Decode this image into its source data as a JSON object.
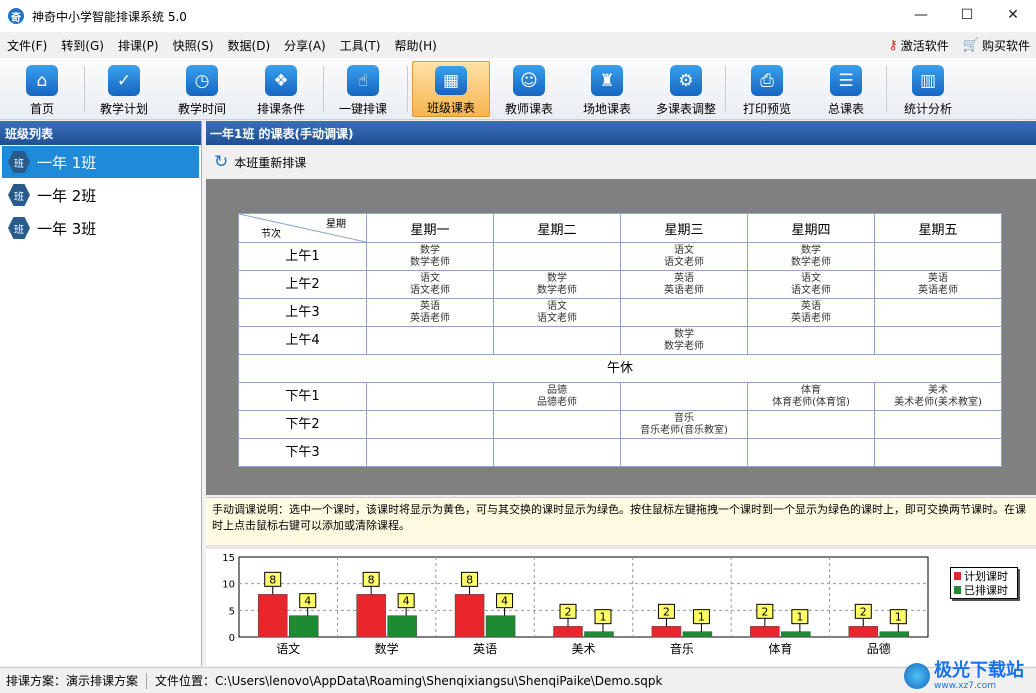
{
  "window": {
    "title": "神奇中小学智能排课系统 5.0",
    "icon_text": "奇"
  },
  "menus": [
    "文件(F)",
    "转到(G)",
    "排课(P)",
    "快照(S)",
    "数据(D)",
    "分享(A)",
    "工具(T)",
    "帮助(H)"
  ],
  "menu_right": {
    "activate": "激活软件",
    "buy": "购买软件"
  },
  "toolbar": [
    {
      "label": "首页",
      "icon": "home-icon",
      "glyph": "⌂"
    },
    {
      "label": "教学计划",
      "icon": "clipboard-check-icon",
      "glyph": "✓"
    },
    {
      "label": "教学时间",
      "icon": "clock-icon",
      "glyph": "◷"
    },
    {
      "label": "排课条件",
      "icon": "cubes-icon",
      "glyph": "❖"
    },
    {
      "label": "一键排课",
      "icon": "hand-pointer-icon",
      "glyph": "☝"
    },
    {
      "label": "班级课表",
      "icon": "calendar-grid-icon",
      "glyph": "▦"
    },
    {
      "label": "教师课表",
      "icon": "teacher-card-icon",
      "glyph": "☺"
    },
    {
      "label": "场地课表",
      "icon": "building-icon",
      "glyph": "♜"
    },
    {
      "label": "多课表调整",
      "icon": "adjust-doc-icon",
      "glyph": "⚙"
    },
    {
      "label": "打印预览",
      "icon": "printer-icon",
      "glyph": "⎙"
    },
    {
      "label": "总课表",
      "icon": "table-icon",
      "glyph": "☰"
    },
    {
      "label": "统计分析",
      "icon": "bar-chart-icon",
      "glyph": "▥"
    }
  ],
  "active_toolbar": "班级课表",
  "sidebar": {
    "header": "班级列表",
    "icon_text": "班",
    "items": [
      {
        "label": "一年 1班",
        "selected": true
      },
      {
        "label": "一年 2班",
        "selected": false
      },
      {
        "label": "一年 3班",
        "selected": false
      }
    ]
  },
  "main": {
    "header": "一年1班 的课表(手动调课)",
    "reschedule_label": "本班重新排课",
    "corner_top": "星期",
    "corner_bottom": "节次",
    "days": [
      "星期一",
      "星期二",
      "星期三",
      "星期四",
      "星期五"
    ],
    "lunch": "午休",
    "periods": [
      {
        "name": "上午1",
        "cells": [
          [
            "数学",
            "数学老师"
          ],
          null,
          [
            "语文",
            "语文老师"
          ],
          [
            "数学",
            "数学老师"
          ],
          null
        ]
      },
      {
        "name": "上午2",
        "cells": [
          [
            "语文",
            "语文老师"
          ],
          [
            "数学",
            "数学老师"
          ],
          [
            "英语",
            "英语老师"
          ],
          [
            "语文",
            "语文老师"
          ],
          [
            "英语",
            "英语老师"
          ]
        ]
      },
      {
        "name": "上午3",
        "cells": [
          [
            "英语",
            "英语老师"
          ],
          [
            "语文",
            "语文老师"
          ],
          null,
          [
            "英语",
            "英语老师"
          ],
          null
        ]
      },
      {
        "name": "上午4",
        "cells": [
          null,
          null,
          [
            "数学",
            "数学老师"
          ],
          null,
          null
        ]
      },
      {
        "name": "下午1",
        "cells": [
          null,
          [
            "品德",
            "品德老师"
          ],
          null,
          [
            "体育",
            "体育老师(体育馆)"
          ],
          [
            "美术",
            "美术老师(美术教室)"
          ]
        ]
      },
      {
        "name": "下午2",
        "cells": [
          null,
          null,
          [
            "音乐",
            "音乐老师(音乐教室)"
          ],
          null,
          null
        ]
      },
      {
        "name": "下午3",
        "cells": [
          null,
          null,
          null,
          null,
          null
        ]
      }
    ],
    "note": "手动调课说明：选中一个课时，该课时将显示为黄色，可与其交换的课时显示为绿色。按住鼠标左键拖拽一个课时到一个显示为绿色的课时上，即可交换两节课时。在课时上点击鼠标右键可以添加或清除课程。"
  },
  "chart_data": {
    "type": "bar",
    "categories": [
      "语文",
      "数学",
      "英语",
      "美术",
      "音乐",
      "体育",
      "品德"
    ],
    "series": [
      {
        "name": "计划课时",
        "values": [
          8,
          8,
          8,
          2,
          2,
          2,
          2
        ],
        "color": "#e8262b"
      },
      {
        "name": "已排课时",
        "values": [
          4,
          4,
          4,
          1,
          1,
          1,
          1
        ],
        "color": "#1e8a32"
      }
    ],
    "ylim": [
      0,
      15
    ],
    "yticks": [
      0,
      5,
      10,
      15
    ],
    "legend": "right",
    "grid": true
  },
  "status": {
    "plan": "排课方案：演示排课方案",
    "file": "文件位置：C:\\Users\\lenovo\\AppData\\Roaming\\Shenqixiangsu\\ShenqiPaike\\Demo.sqpk"
  },
  "watermark": {
    "main": "极光下载站",
    "sub": "www.xz7.com"
  }
}
